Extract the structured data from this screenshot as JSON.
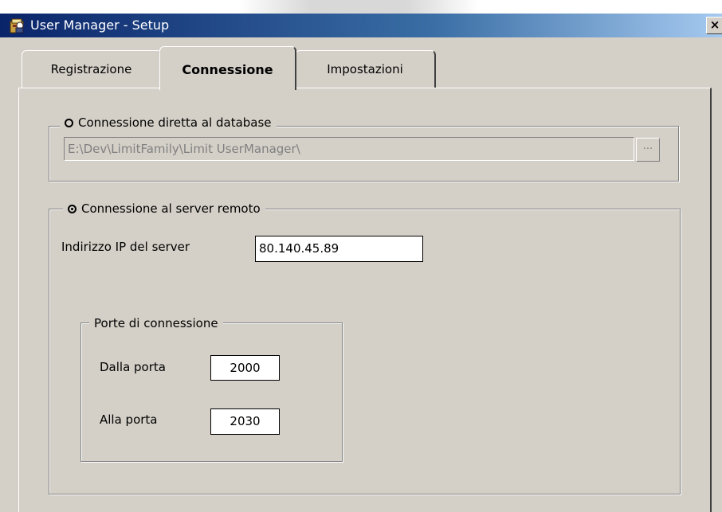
{
  "window": {
    "title": "User Manager - Setup",
    "close_label": "×",
    "icon": "user-manager-app-icon"
  },
  "tabs": [
    {
      "label": "Registrazione",
      "active": false
    },
    {
      "label": "Connessione",
      "active": true
    },
    {
      "label": "Impostazioni",
      "active": false
    }
  ],
  "direct_connection": {
    "label": "Connessione diretta al database",
    "selected": false,
    "path_value": "E:\\Dev\\LimitFamily\\Limit UserManager\\",
    "browse_label": "..."
  },
  "remote_connection": {
    "label": "Connessione al server remoto",
    "selected": true,
    "ip_label": "Indirizzo IP del server",
    "ip_value": "80.140.45.89",
    "ports": {
      "group_label": "Porte di connessione",
      "from_label": "Dalla porta",
      "from_value": "2000",
      "to_label": "Alla porta",
      "to_value": "2030"
    }
  },
  "colors": {
    "titlebar_start": "#0a246a",
    "titlebar_end": "#a6caf0",
    "window_face": "#d4d0c8"
  }
}
